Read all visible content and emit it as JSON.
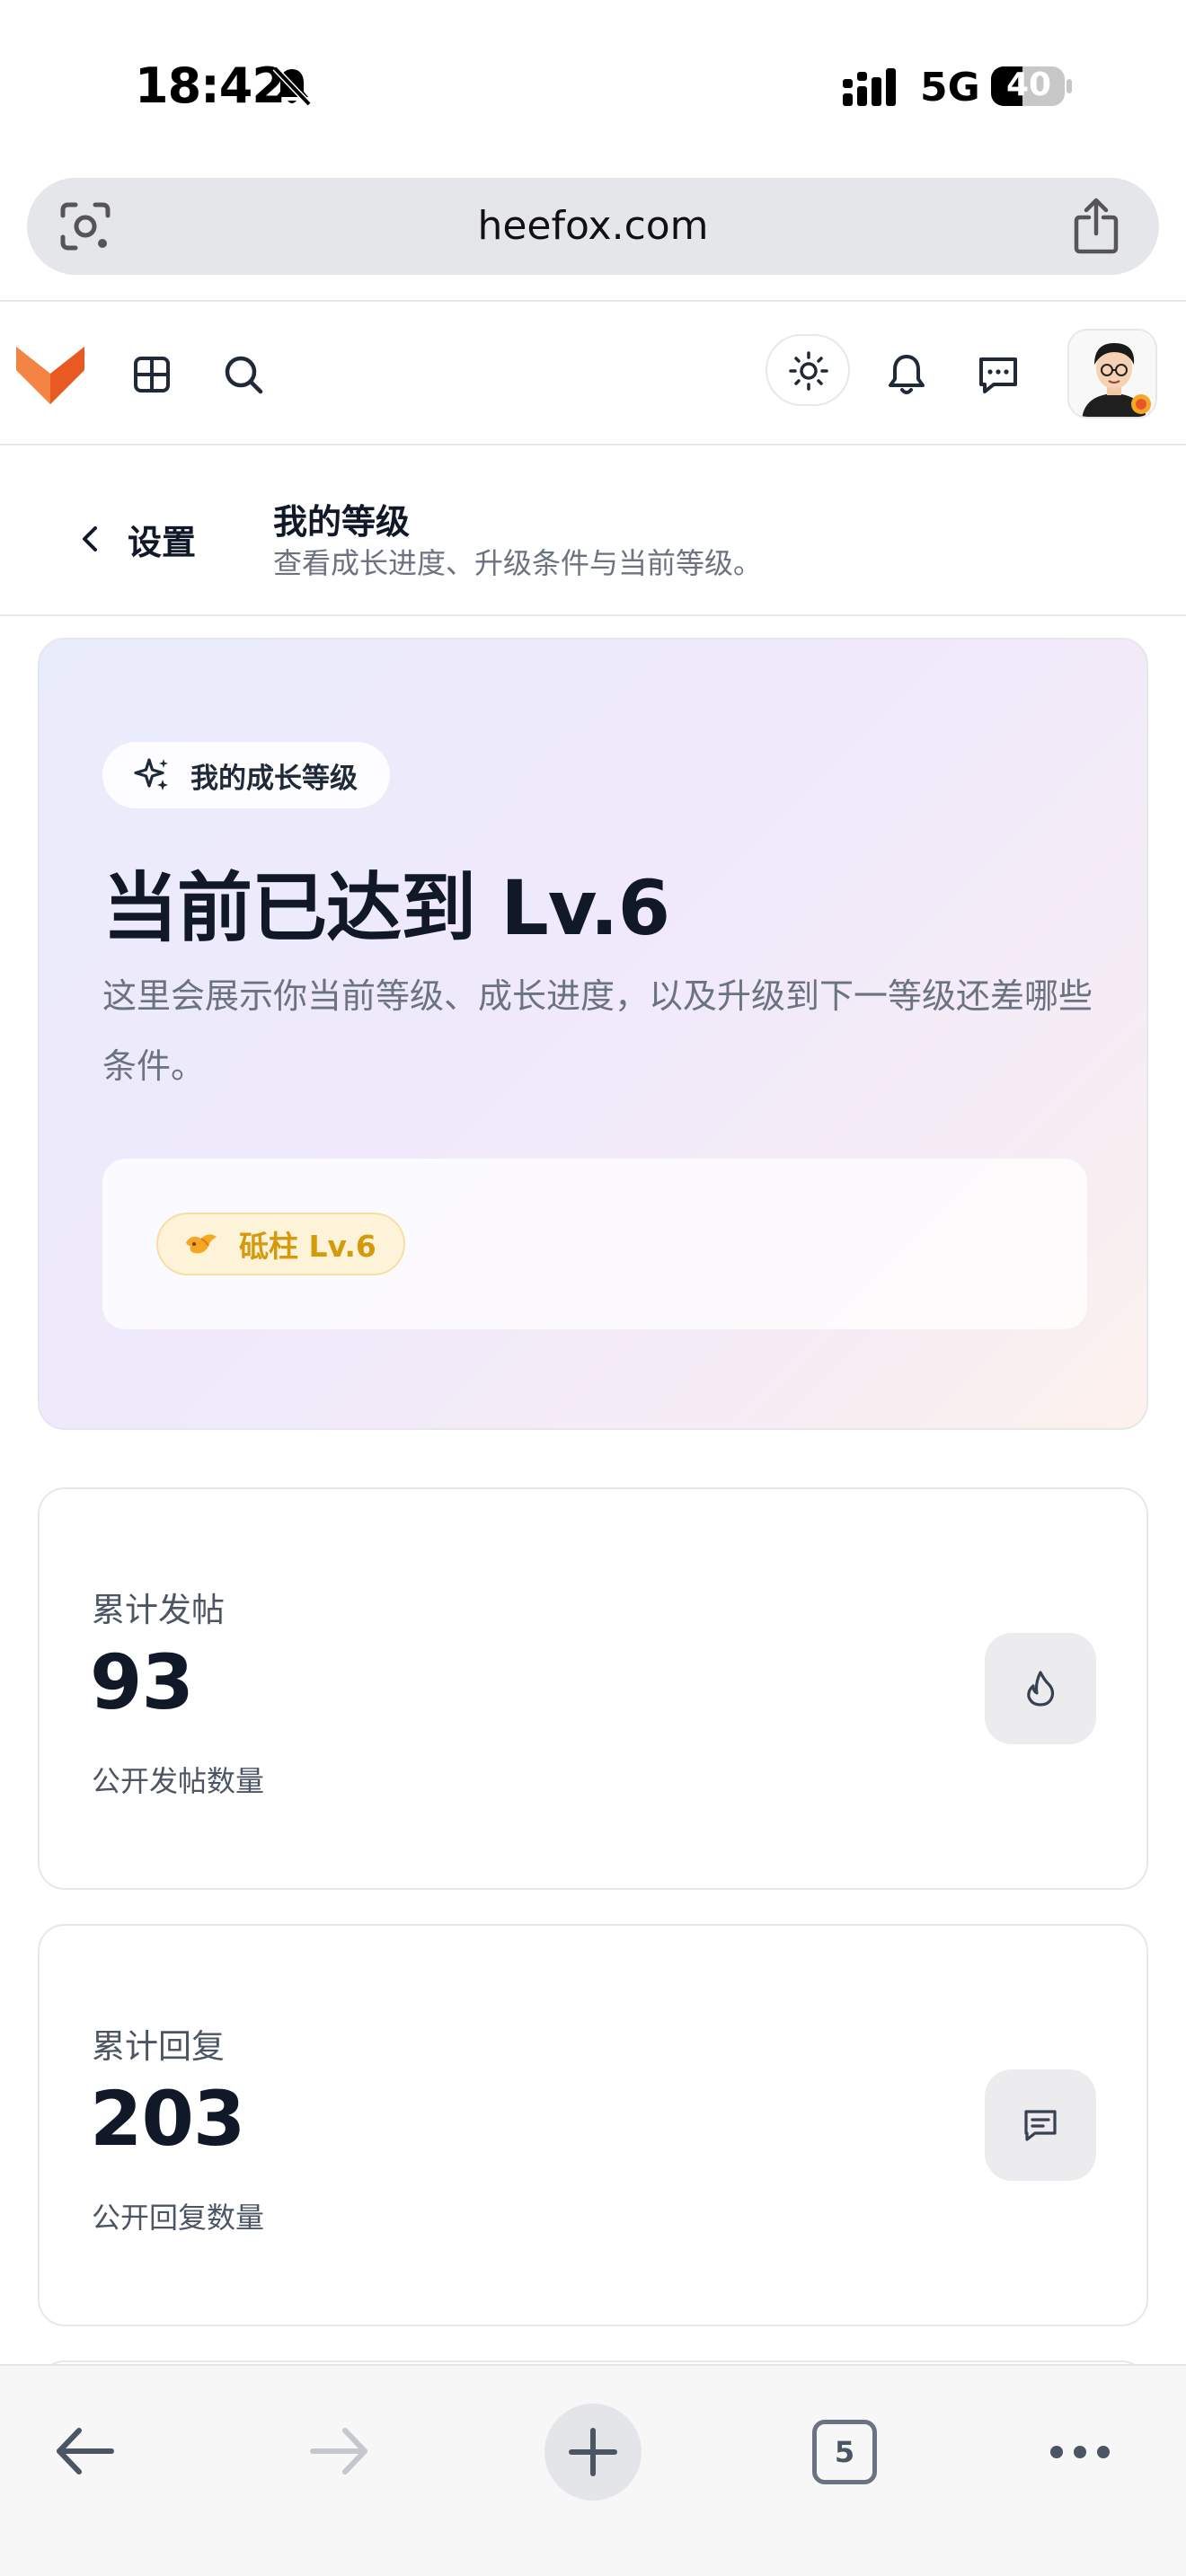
{
  "status_bar": {
    "time": "18:42",
    "network": "5G",
    "battery": "40"
  },
  "browser": {
    "url": "heefox.com",
    "open_tabs": "5"
  },
  "site_header": {
    "icons": [
      "fox-logo-icon",
      "grid-icon",
      "search-icon",
      "sun-icon",
      "bell-icon",
      "chat-icon"
    ]
  },
  "page_header": {
    "back_label": "设置",
    "title": "我的等级",
    "subtitle": "查看成长进度、升级条件与当前等级。"
  },
  "hero": {
    "pill_label": "我的成长等级",
    "title": "当前已达到 Lv.6",
    "description": "这里会展示你当前等级、成长进度，以及升级到下一等级还差哪些条件。",
    "badge": "砥柱 Lv.6"
  },
  "stats": [
    {
      "label": "累计发帖",
      "value": "93",
      "caption": "公开发帖数量",
      "icon": "flame-icon"
    },
    {
      "label": "累计回复",
      "value": "203",
      "caption": "公开回复数量",
      "icon": "message-icon"
    }
  ],
  "colors": {
    "accent_orange": "#f2672c",
    "badge_text": "#d49a0c",
    "badge_bg": "#fdf3d9",
    "text_primary": "#111827",
    "text_secondary": "#6b7280"
  }
}
